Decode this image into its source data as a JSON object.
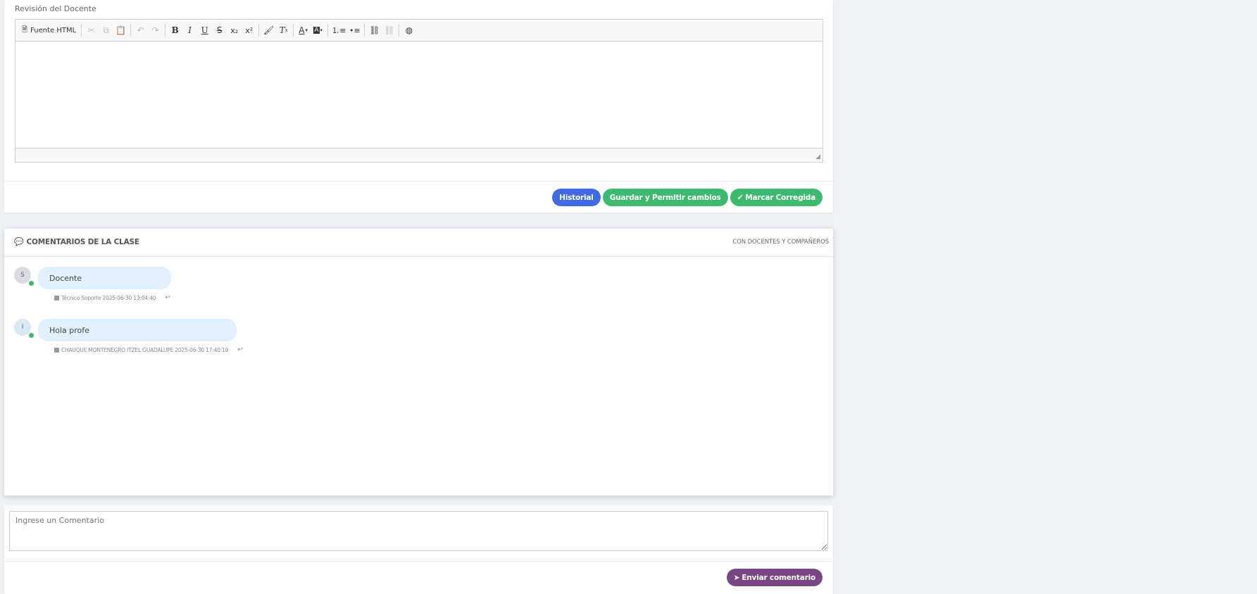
{
  "review": {
    "label": "Revisión del Docente",
    "toolbar": {
      "source_label": "Fuente HTML"
    },
    "buttons": {
      "history": "Historial",
      "save_allow": "Guardar y Permitir cambios",
      "mark_corrected": "Marcar Corregida"
    }
  },
  "comments": {
    "title": "COMENTARIOS DE LA CLASE",
    "subtitle": "CON DOCENTES Y COMPAÑEROS",
    "items": [
      {
        "initial": "S",
        "text": "Docente",
        "meta": "Técnico Soporte 2025-06-30 13:04:40"
      },
      {
        "initial": "I",
        "text": "Hola profe",
        "meta": "CHAUQUE MONTENEGRO ITZEL GUADALUPE 2025-06-30 17:40:19"
      }
    ]
  },
  "input": {
    "placeholder": "Ingrese un Comentario",
    "send_label": "Enviar comentario"
  },
  "colors": {
    "history_button": "#4169e1",
    "green_buttons": "#3dba6f",
    "send_button": "#7b4585",
    "bubble": "#e0f0fd",
    "online_dot": "#3dba6f"
  }
}
